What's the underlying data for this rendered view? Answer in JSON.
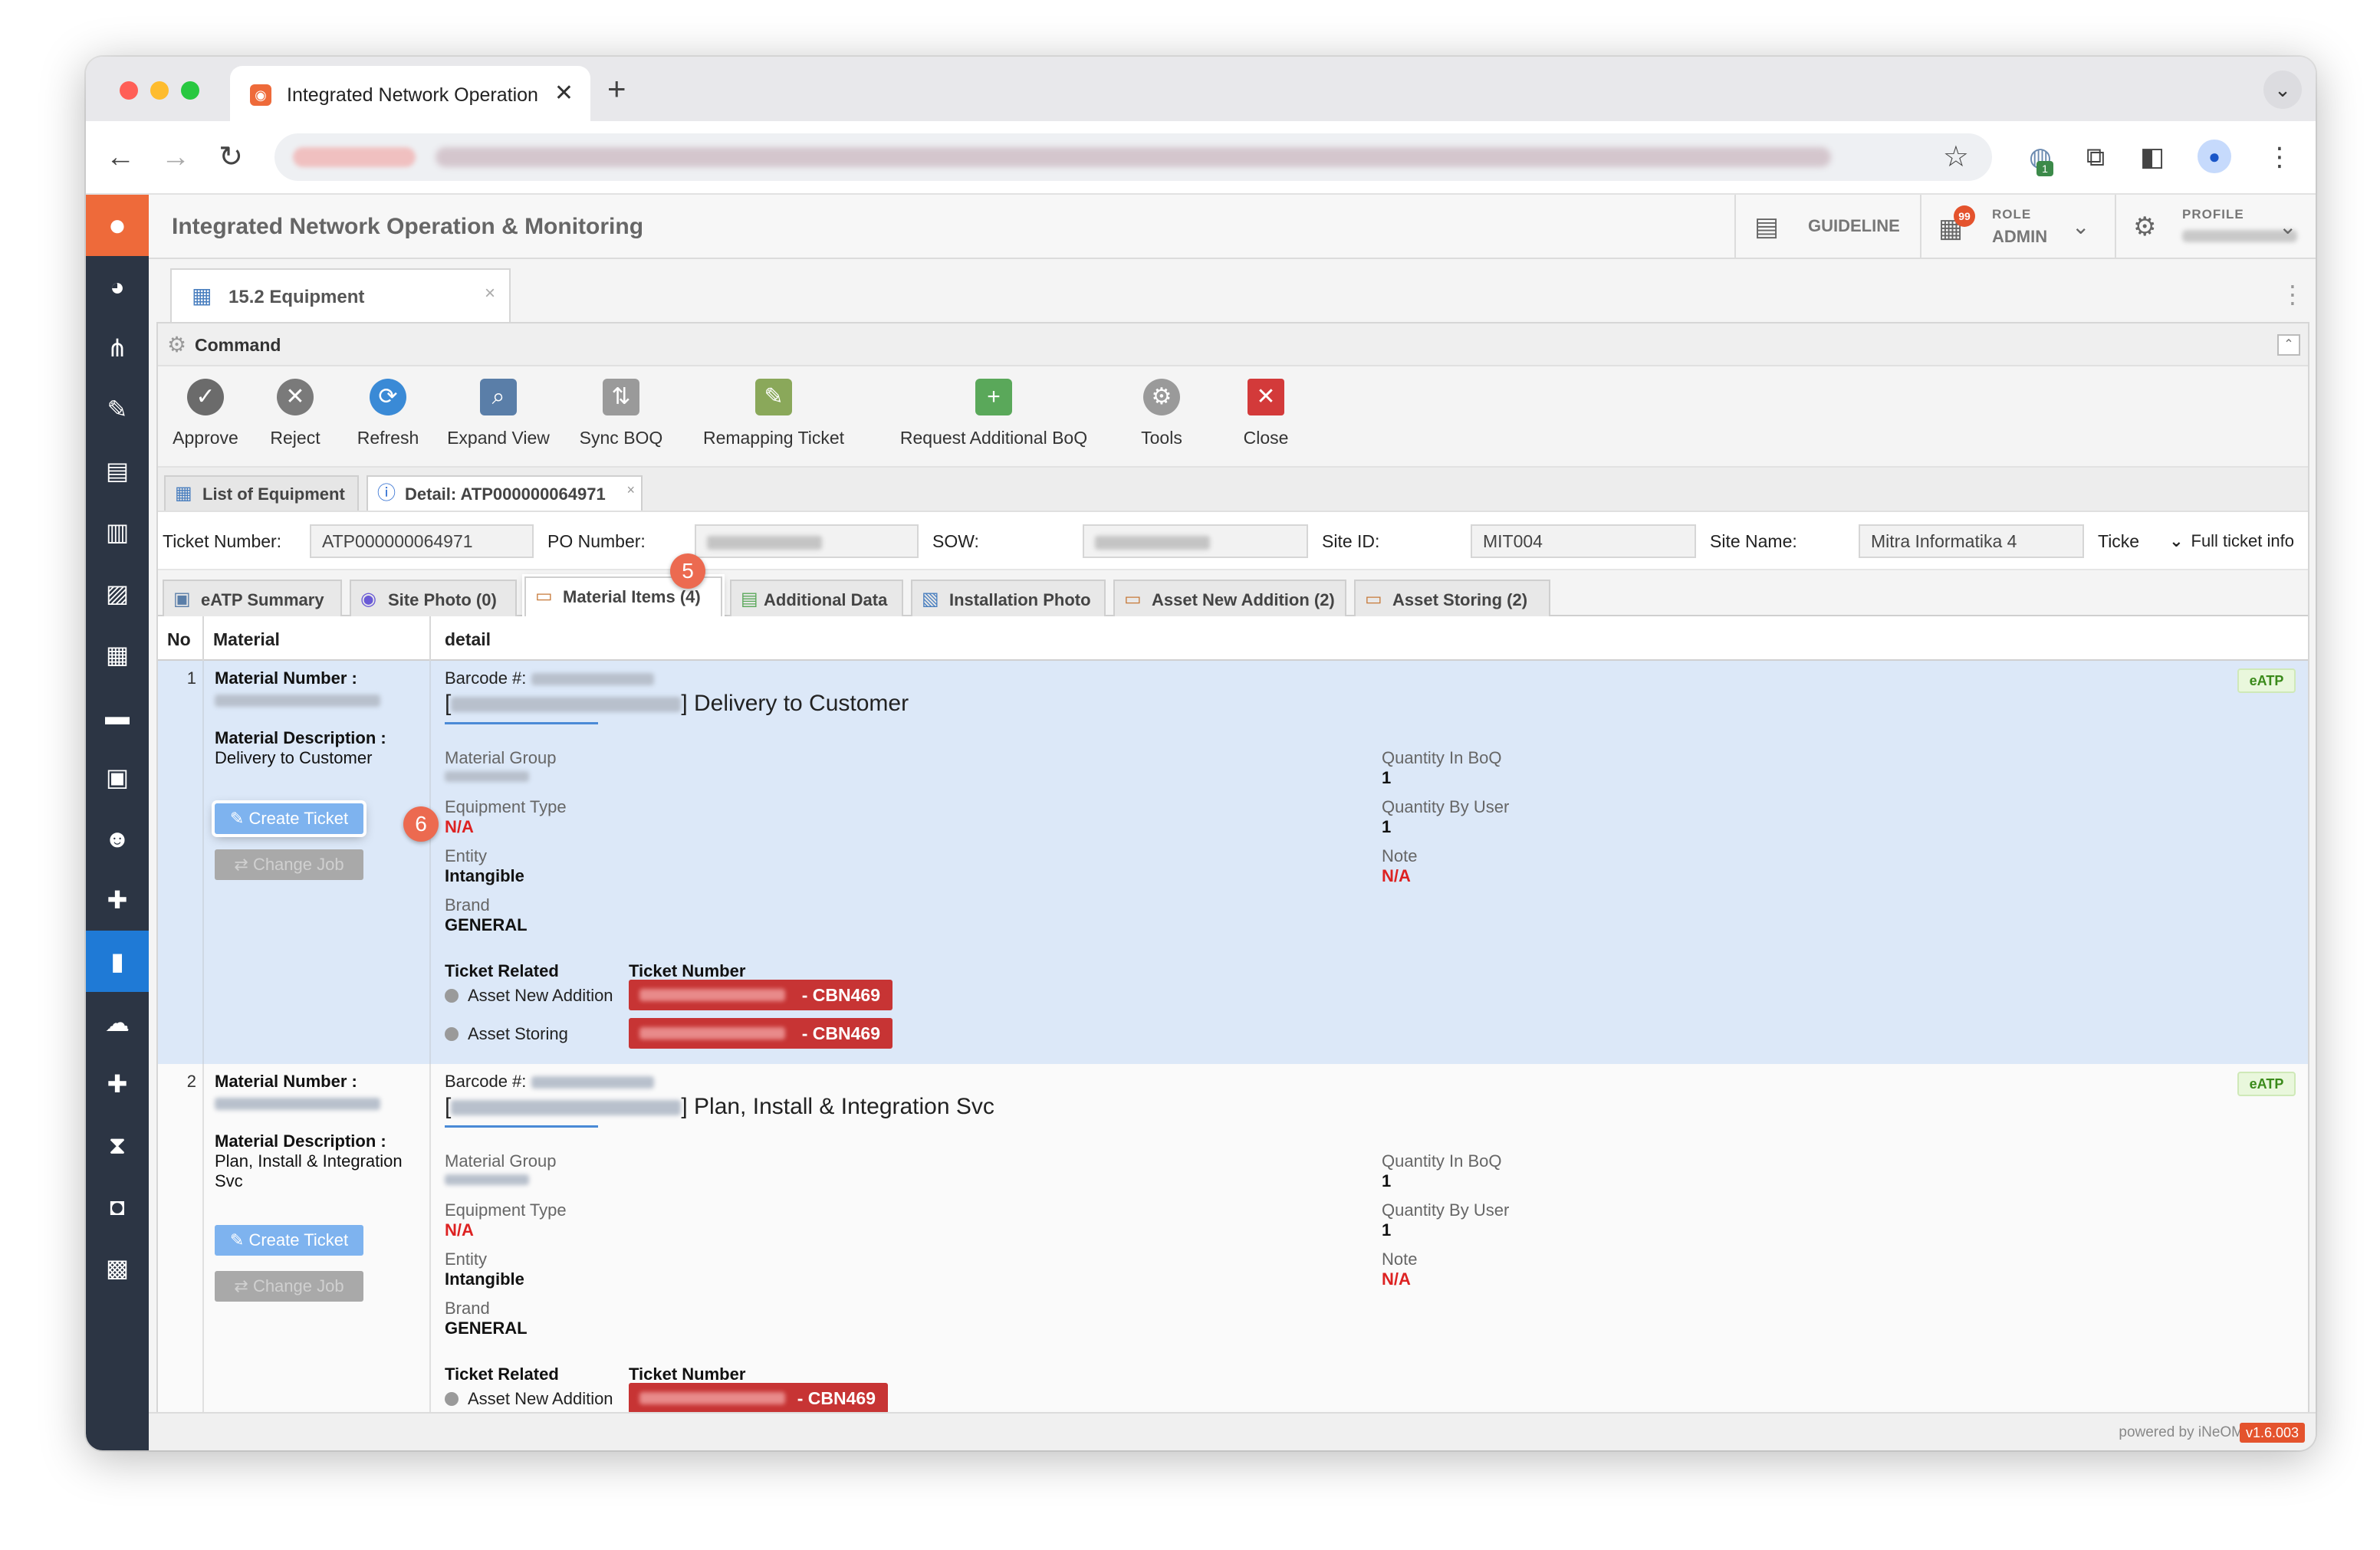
{
  "browser": {
    "tab_title": "Integrated Network Operation & Monitoring",
    "tab_close": "✕",
    "new_tab": "+",
    "tab_menu": "⌄",
    "extension_badge": "1"
  },
  "app": {
    "title": "Integrated Network Operation & Monitoring",
    "guideline": "GUIDELINE",
    "notification_count": "99",
    "role_label": "ROLE",
    "role_value": "ADMIN",
    "profile_label": "PROFILE"
  },
  "doc_tab": {
    "label": "15.2 Equipment"
  },
  "command": {
    "header": "Command",
    "buttons": [
      {
        "label": "Approve",
        "icon": "check-icon",
        "color": "#6b6b6b"
      },
      {
        "label": "Reject",
        "icon": "x-circle-icon",
        "color": "#7a7a7a"
      },
      {
        "label": "Refresh",
        "icon": "refresh-icon",
        "color": "#3a8ad6"
      },
      {
        "label": "Expand View",
        "icon": "magnifier-doc-icon",
        "color": "#5a7ea8"
      },
      {
        "label": "Sync BOQ",
        "icon": "sync-doc-icon",
        "color": "#9a9a9a"
      },
      {
        "label": "Remapping Ticket",
        "icon": "pencil-icon",
        "color": "#8aa85a"
      },
      {
        "label": "Request Additional BoQ",
        "icon": "doc-add-icon",
        "color": "#5aa85a"
      },
      {
        "label": "Tools",
        "icon": "gear-icon",
        "color": "#9a9a9a"
      },
      {
        "label": "Close",
        "icon": "close-icon",
        "color": "#d33a3a"
      }
    ]
  },
  "subtabs": {
    "list": "List of Equipment",
    "detail": "Detail: ATP000000064971"
  },
  "info": {
    "ticket_number_label": "Ticket Number:",
    "ticket_number": "ATP000000064971",
    "po_number_label": "PO Number:",
    "sow_label": "SOW:",
    "site_id_label": "Site ID:",
    "site_id": "MIT004",
    "site_name_label": "Site Name:",
    "site_name": "Mitra Informatika 4",
    "ticket_trunc_label": "Ticke",
    "full_ticket_info": "Full ticket info"
  },
  "main_tabs": [
    {
      "label": "eATP Summary"
    },
    {
      "label": "Site Photo (0)"
    },
    {
      "label": "Material Items (4)"
    },
    {
      "label": "Additional Data"
    },
    {
      "label": "Installation Photo"
    },
    {
      "label": "Asset New Addition (2)"
    },
    {
      "label": "Asset Storing (2)"
    }
  ],
  "callouts": {
    "five": "5",
    "six": "6"
  },
  "grid": {
    "col_no": "No",
    "col_material": "Material",
    "col_detail": "detail"
  },
  "labels": {
    "material_number": "Material Number :",
    "material_description": "Material Description :",
    "create_ticket": "Create Ticket",
    "change_job": "Change Job",
    "barcode": "Barcode #:",
    "material_group": "Material Group",
    "equipment_type": "Equipment Type",
    "entity": "Entity",
    "brand": "Brand",
    "quantity_in_boq": "Quantity In BoQ",
    "quantity_by_user": "Quantity By User",
    "note": "Note",
    "ticket_related": "Ticket Related",
    "ticket_number": "Ticket Number",
    "eatp": "eATP"
  },
  "rows": [
    {
      "no": "1",
      "description": "Delivery to Customer",
      "title_suffix": "] Delivery to Customer",
      "equipment_type": "N/A",
      "entity": "Intangible",
      "brand": "GENERAL",
      "quantity_in_boq": "1",
      "quantity_by_user": "1",
      "note": "N/A",
      "tickets": [
        {
          "name": "Asset New Addition",
          "number": "- CBN469"
        },
        {
          "name": "Asset Storing",
          "number": "- CBN469"
        }
      ]
    },
    {
      "no": "2",
      "description": "Plan, Install & Integration Svc",
      "title_suffix": "] Plan, Install & Integration Svc",
      "equipment_type": "N/A",
      "entity": "Intangible",
      "brand": "GENERAL",
      "quantity_in_boq": "1",
      "quantity_by_user": "1",
      "note": "N/A",
      "tickets": [
        {
          "name": "Asset New Addition",
          "number": "- CBN469"
        }
      ]
    }
  ],
  "footer": {
    "powered": "powered by iNeOM",
    "version": "v1.6.003"
  }
}
